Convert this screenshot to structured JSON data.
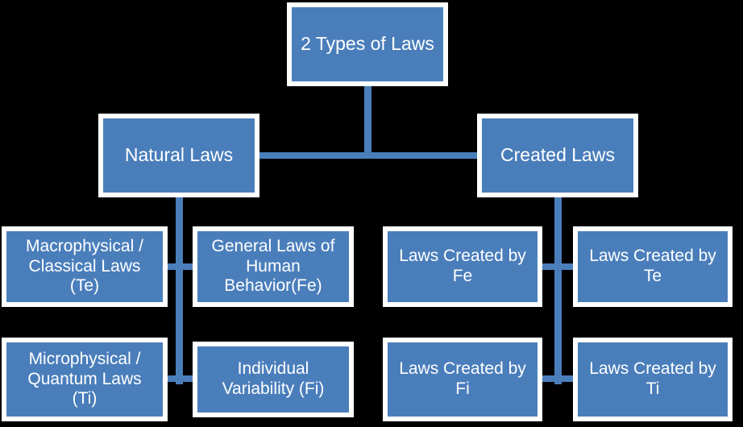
{
  "diagram": {
    "title": "2 Types of Laws",
    "background_color": "#000000",
    "node_fill_color": "#4a7ebb",
    "node_border_color": "#ffffff",
    "node_text_color": "#ffffff",
    "connector_color": "#4a7ebb"
  },
  "nodes": {
    "root": {
      "label": "2 Types of Laws"
    },
    "natural": {
      "label": "Natural Laws"
    },
    "created": {
      "label": "Created Laws"
    },
    "macrophysical": {
      "label": "Macrophysical /\nClassical Laws\n(Te)"
    },
    "general_human_behavior": {
      "label": "General Laws of\nHuman\nBehavior(Fe)"
    },
    "microphysical": {
      "label": "Microphysical /\nQuantum Laws\n(Ti)"
    },
    "individual_variability": {
      "label": "Individual\nVariability (Fi)"
    },
    "laws_created_by_fe": {
      "label": "Laws Created by\nFe"
    },
    "laws_created_by_te": {
      "label": "Laws Created by\nTe"
    },
    "laws_created_by_fi": {
      "label": "Laws Created by\nFi"
    },
    "laws_created_by_ti": {
      "label": "Laws Created by\nTi"
    }
  },
  "chart_data": {
    "type": "table",
    "title": "2 Types of Laws",
    "hierarchy": [
      {
        "label": "2 Types of Laws",
        "level": 0,
        "children": [
          {
            "label": "Natural Laws",
            "level": 1,
            "children": [
              {
                "label": "Macrophysical / Classical Laws (Te)",
                "level": 2
              },
              {
                "label": "General Laws of Human Behavior(Fe)",
                "level": 2
              },
              {
                "label": "Microphysical / Quantum Laws (Ti)",
                "level": 2
              },
              {
                "label": "Individual Variability (Fi)",
                "level": 2
              }
            ]
          },
          {
            "label": "Created Laws",
            "level": 1,
            "children": [
              {
                "label": "Laws Created by Fe",
                "level": 2
              },
              {
                "label": "Laws Created by Te",
                "level": 2
              },
              {
                "label": "Laws Created by Fi",
                "level": 2
              },
              {
                "label": "Laws Created by Ti",
                "level": 2
              }
            ]
          }
        ]
      }
    ]
  }
}
